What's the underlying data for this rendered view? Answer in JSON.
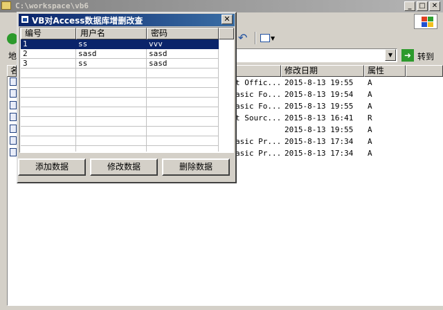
{
  "explorer": {
    "title": "C:\\workspace\\vb6",
    "address_label": "地",
    "go_label": "转到",
    "columns": {
      "name": "名",
      "modified": "修改日期",
      "attributes": "属性"
    },
    "files": [
      {
        "type": "t Offic...",
        "modified": "2015-8-13 19:55",
        "attr": "A"
      },
      {
        "type": "asic Fo...",
        "modified": "2015-8-13 19:54",
        "attr": "A"
      },
      {
        "type": "asic Fo...",
        "modified": "2015-8-13 19:55",
        "attr": "A"
      },
      {
        "type": "t Sourc...",
        "modified": "2015-8-13 16:41",
        "attr": "R"
      },
      {
        "type": "",
        "modified": "2015-8-13 19:55",
        "attr": "A"
      },
      {
        "type": "asic Pr...",
        "modified": "2015-8-13 17:34",
        "attr": "A"
      },
      {
        "type": "asic Pr...",
        "modified": "2015-8-13 17:34",
        "attr": "A"
      }
    ]
  },
  "form": {
    "title": "VB对Access数据库增删改查",
    "close_glyph": "✕",
    "grid": {
      "headers": [
        "编号",
        "用户名",
        "密码"
      ],
      "rows": [
        [
          "1",
          "ss",
          "vvv"
        ],
        [
          "2",
          "sasd",
          "sasd"
        ],
        [
          "3",
          "ss",
          "sasd"
        ]
      ],
      "selected_row": 0
    },
    "buttons": {
      "add": "添加数据",
      "edit": "修改数据",
      "delete": "删除数据"
    }
  }
}
